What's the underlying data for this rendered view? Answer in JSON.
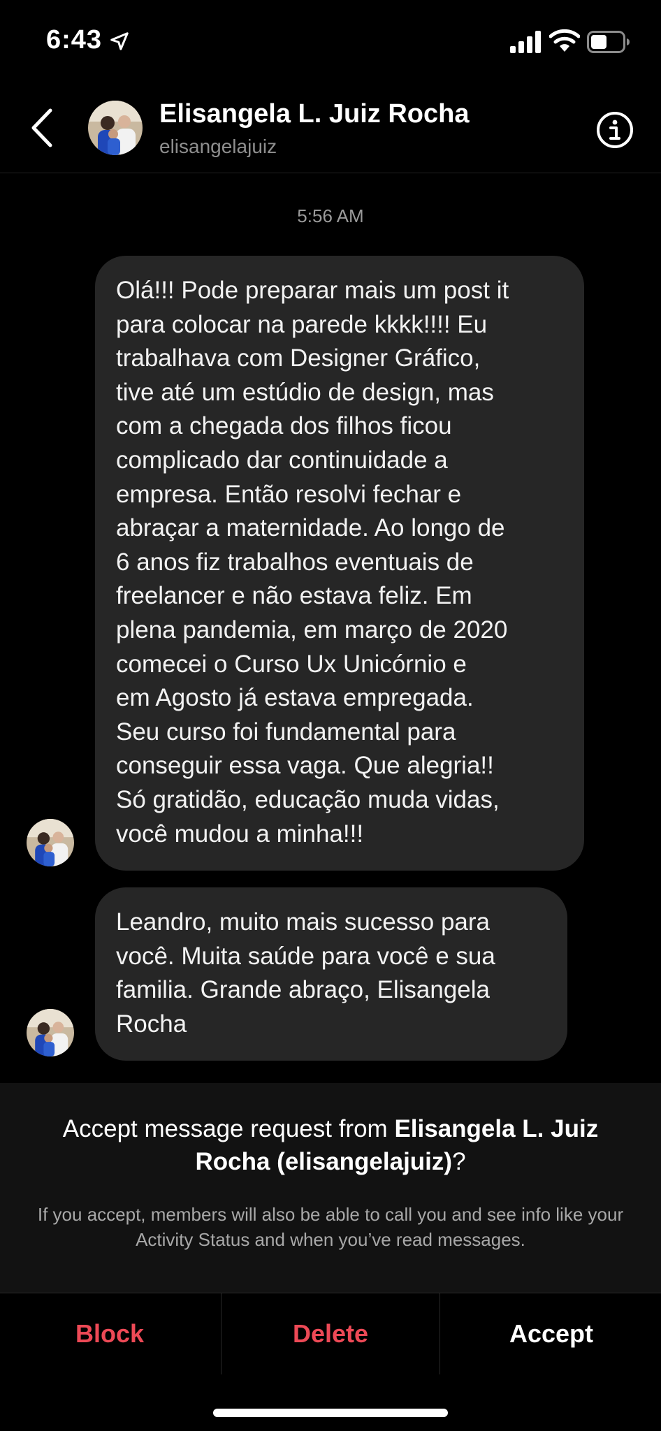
{
  "status_bar": {
    "time": "6:43",
    "icons": [
      "location-arrow-icon",
      "signal-icon",
      "wifi-icon",
      "battery-icon"
    ]
  },
  "header": {
    "name": "Elisangela L. Juiz Rocha",
    "username": "elisangelajuiz",
    "icons": [
      "back-icon",
      "info-icon"
    ]
  },
  "conversation": {
    "timestamp": "5:56 AM",
    "messages": [
      {
        "text": "Olá!!! Pode preparar mais um post it\npara colocar na parede kkkk!!!! Eu\ntrabalhava com Designer Gráfico,\ntive até um estúdio de design, mas\ncom a chegada dos filhos ficou\ncomplicado dar continuidade a\nempresa. Então resolvi fechar e\nabraçar a maternidade. Ao longo de\n6 anos fiz trabalhos eventuais de\nfreelancer e não estava feliz. Em\nplena pandemia, em março de 2020\ncomecei  o Curso Ux Unicórnio e\nem Agosto já estava empregada.\nSeu curso foi fundamental para\nconseguir essa vaga.  Que alegria!!\nSó gratidão, educação muda vidas,\nvocê mudou a minha!!!"
      },
      {
        "text": "Leandro, muito mais sucesso para\nvocê. Muita saúde para você e sua\nfamilia. Grande abraço, Elisangela\nRocha"
      }
    ]
  },
  "request": {
    "title_prefix": "Accept message request from ",
    "title_name": "Elisangela L. Juiz Rocha (elisangelajuiz)",
    "title_suffix": "?",
    "note": "If you accept, members will also be able to call you and see info like your Activity Status and when you’ve read messages."
  },
  "actions": {
    "block": "Block",
    "delete": "Delete",
    "accept": "Accept"
  },
  "colors": {
    "background": "#000000",
    "bubble": "#262626",
    "panel": "#121212",
    "destructive": "#ed4956",
    "secondary_text": "#8e8e8e"
  }
}
